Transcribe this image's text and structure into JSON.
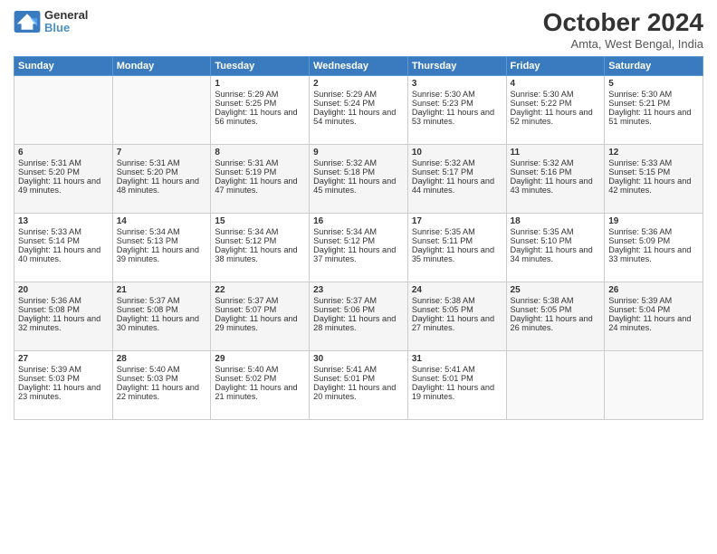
{
  "header": {
    "logo_line1": "General",
    "logo_line2": "Blue",
    "month_title": "October 2024",
    "location": "Amta, West Bengal, India"
  },
  "days_of_week": [
    "Sunday",
    "Monday",
    "Tuesday",
    "Wednesday",
    "Thursday",
    "Friday",
    "Saturday"
  ],
  "weeks": [
    [
      {
        "day": "",
        "info": ""
      },
      {
        "day": "",
        "info": ""
      },
      {
        "day": "1",
        "info": "Sunrise: 5:29 AM\nSunset: 5:25 PM\nDaylight: 11 hours and 56 minutes."
      },
      {
        "day": "2",
        "info": "Sunrise: 5:29 AM\nSunset: 5:24 PM\nDaylight: 11 hours and 54 minutes."
      },
      {
        "day": "3",
        "info": "Sunrise: 5:30 AM\nSunset: 5:23 PM\nDaylight: 11 hours and 53 minutes."
      },
      {
        "day": "4",
        "info": "Sunrise: 5:30 AM\nSunset: 5:22 PM\nDaylight: 11 hours and 52 minutes."
      },
      {
        "day": "5",
        "info": "Sunrise: 5:30 AM\nSunset: 5:21 PM\nDaylight: 11 hours and 51 minutes."
      }
    ],
    [
      {
        "day": "6",
        "info": "Sunrise: 5:31 AM\nSunset: 5:20 PM\nDaylight: 11 hours and 49 minutes."
      },
      {
        "day": "7",
        "info": "Sunrise: 5:31 AM\nSunset: 5:20 PM\nDaylight: 11 hours and 48 minutes."
      },
      {
        "day": "8",
        "info": "Sunrise: 5:31 AM\nSunset: 5:19 PM\nDaylight: 11 hours and 47 minutes."
      },
      {
        "day": "9",
        "info": "Sunrise: 5:32 AM\nSunset: 5:18 PM\nDaylight: 11 hours and 45 minutes."
      },
      {
        "day": "10",
        "info": "Sunrise: 5:32 AM\nSunset: 5:17 PM\nDaylight: 11 hours and 44 minutes."
      },
      {
        "day": "11",
        "info": "Sunrise: 5:32 AM\nSunset: 5:16 PM\nDaylight: 11 hours and 43 minutes."
      },
      {
        "day": "12",
        "info": "Sunrise: 5:33 AM\nSunset: 5:15 PM\nDaylight: 11 hours and 42 minutes."
      }
    ],
    [
      {
        "day": "13",
        "info": "Sunrise: 5:33 AM\nSunset: 5:14 PM\nDaylight: 11 hours and 40 minutes."
      },
      {
        "day": "14",
        "info": "Sunrise: 5:34 AM\nSunset: 5:13 PM\nDaylight: 11 hours and 39 minutes."
      },
      {
        "day": "15",
        "info": "Sunrise: 5:34 AM\nSunset: 5:12 PM\nDaylight: 11 hours and 38 minutes."
      },
      {
        "day": "16",
        "info": "Sunrise: 5:34 AM\nSunset: 5:12 PM\nDaylight: 11 hours and 37 minutes."
      },
      {
        "day": "17",
        "info": "Sunrise: 5:35 AM\nSunset: 5:11 PM\nDaylight: 11 hours and 35 minutes."
      },
      {
        "day": "18",
        "info": "Sunrise: 5:35 AM\nSunset: 5:10 PM\nDaylight: 11 hours and 34 minutes."
      },
      {
        "day": "19",
        "info": "Sunrise: 5:36 AM\nSunset: 5:09 PM\nDaylight: 11 hours and 33 minutes."
      }
    ],
    [
      {
        "day": "20",
        "info": "Sunrise: 5:36 AM\nSunset: 5:08 PM\nDaylight: 11 hours and 32 minutes."
      },
      {
        "day": "21",
        "info": "Sunrise: 5:37 AM\nSunset: 5:08 PM\nDaylight: 11 hours and 30 minutes."
      },
      {
        "day": "22",
        "info": "Sunrise: 5:37 AM\nSunset: 5:07 PM\nDaylight: 11 hours and 29 minutes."
      },
      {
        "day": "23",
        "info": "Sunrise: 5:37 AM\nSunset: 5:06 PM\nDaylight: 11 hours and 28 minutes."
      },
      {
        "day": "24",
        "info": "Sunrise: 5:38 AM\nSunset: 5:05 PM\nDaylight: 11 hours and 27 minutes."
      },
      {
        "day": "25",
        "info": "Sunrise: 5:38 AM\nSunset: 5:05 PM\nDaylight: 11 hours and 26 minutes."
      },
      {
        "day": "26",
        "info": "Sunrise: 5:39 AM\nSunset: 5:04 PM\nDaylight: 11 hours and 24 minutes."
      }
    ],
    [
      {
        "day": "27",
        "info": "Sunrise: 5:39 AM\nSunset: 5:03 PM\nDaylight: 11 hours and 23 minutes."
      },
      {
        "day": "28",
        "info": "Sunrise: 5:40 AM\nSunset: 5:03 PM\nDaylight: 11 hours and 22 minutes."
      },
      {
        "day": "29",
        "info": "Sunrise: 5:40 AM\nSunset: 5:02 PM\nDaylight: 11 hours and 21 minutes."
      },
      {
        "day": "30",
        "info": "Sunrise: 5:41 AM\nSunset: 5:01 PM\nDaylight: 11 hours and 20 minutes."
      },
      {
        "day": "31",
        "info": "Sunrise: 5:41 AM\nSunset: 5:01 PM\nDaylight: 11 hours and 19 minutes."
      },
      {
        "day": "",
        "info": ""
      },
      {
        "day": "",
        "info": ""
      }
    ]
  ]
}
